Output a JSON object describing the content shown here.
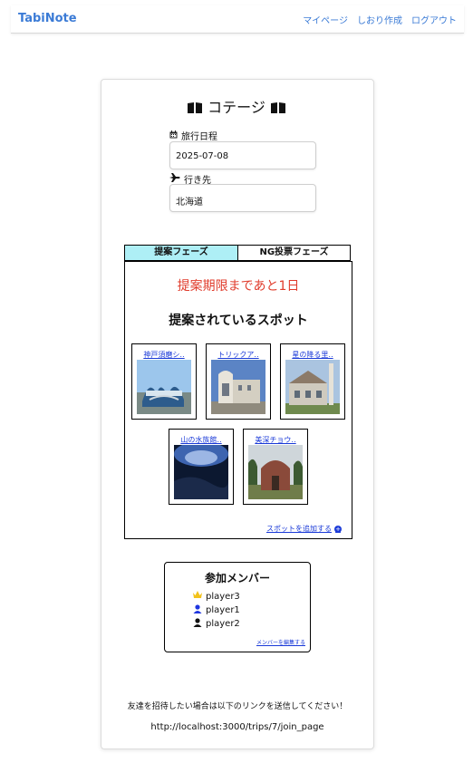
{
  "nav": {
    "brand": "TabiNote",
    "links": [
      "マイページ",
      "しおり作成",
      "ログアウト"
    ],
    "color": "#3b7bd6"
  },
  "trip": {
    "title": "コテージ",
    "date_label": "旅行日程",
    "date_value": "2025-07-08",
    "destination_label": "行き先",
    "destination_value": "北海道"
  },
  "phases": {
    "tabs": [
      "提案フェーズ",
      "NG投票フェーズ"
    ],
    "active_index": 0,
    "active_color": "#aeeff6"
  },
  "proposal": {
    "deadline": "提案期限まであと1日",
    "deadline_color": "#e03b2b",
    "heading": "提案されているスポット",
    "spots": [
      {
        "name": "神戸須磨シ‥"
      },
      {
        "name": "トリックア‥"
      },
      {
        "name": "星の降る里‥"
      },
      {
        "name": "山の水族館‥"
      },
      {
        "name": "美深チョウ‥"
      }
    ],
    "add_spot": "スポットを追加する"
  },
  "members": {
    "title": "参加メンバー",
    "list": [
      {
        "name": "player3",
        "icon": "crown-icon"
      },
      {
        "name": "player1",
        "icon": "user-icon-blue"
      },
      {
        "name": "player2",
        "icon": "user-icon-black"
      }
    ],
    "edit": "メンバーを編集する"
  },
  "invite": {
    "text": "友達を招待したい場合は以下のリンクを送信してください！",
    "link": "http://localhost:3000/trips/7/join_page"
  }
}
